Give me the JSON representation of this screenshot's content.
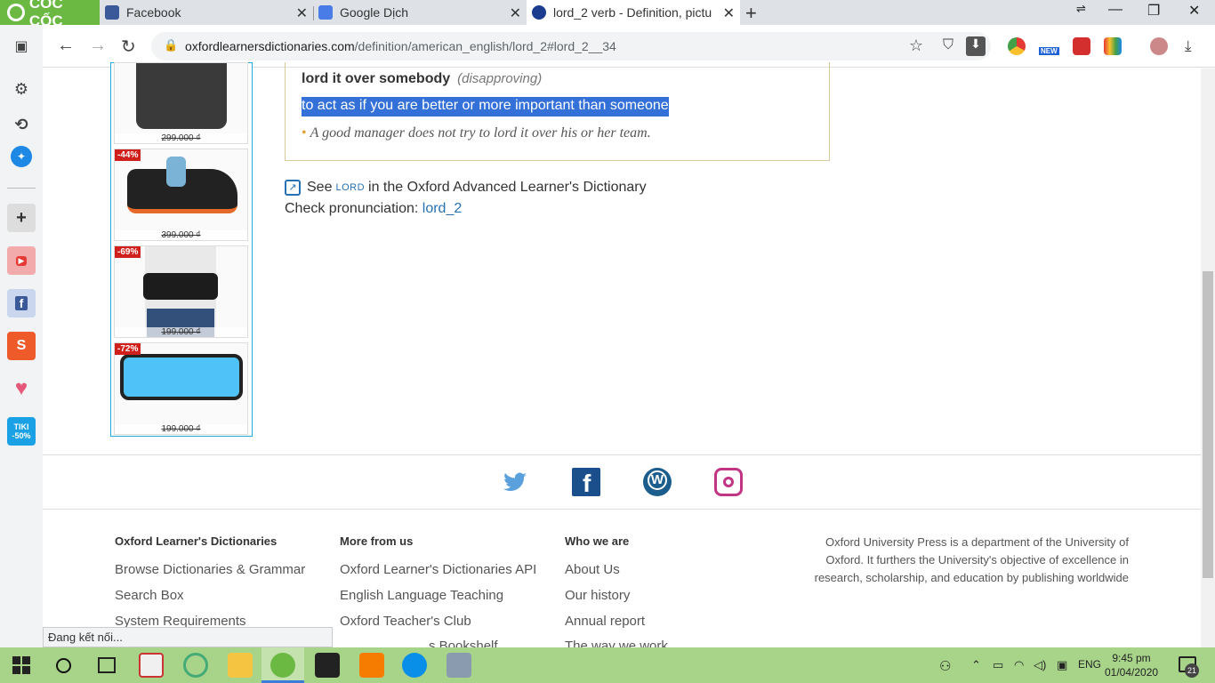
{
  "browser": {
    "brand": "CỐC CỐC",
    "tabs": [
      {
        "title": "Facebook"
      },
      {
        "title": "Google Dịch"
      },
      {
        "title": "lord_2 verb - Definition, pictu"
      }
    ],
    "url_host": "oxfordlearnersdictionaries.com",
    "url_path": "/definition/american_english/lord_2#lord_2__34",
    "status_text": "Đang kết nối...",
    "ext_new_badge": "NEW"
  },
  "sidebar": {
    "items": [
      "sidebar-toggle",
      "settings",
      "history",
      "messenger",
      "add",
      "youtube",
      "facebook",
      "shopee",
      "heart",
      "tiki"
    ],
    "tiki_label": "TIKI -50%"
  },
  "ads": [
    {
      "discount": "",
      "price": "299.000 ₫"
    },
    {
      "discount": "-44%",
      "price": "399.000 ₫"
    },
    {
      "discount": "-69%",
      "price": "199.000 ₫"
    },
    {
      "discount": "-72%",
      "price": "199.000 ₫"
    }
  ],
  "entry": {
    "phrase": "lord it over somebody",
    "label": "(disapproving)",
    "definition": "to act as if you are better or more important than someone",
    "example": "A good manager does not try to lord it over his or her team.",
    "see_prefix": "See",
    "see_word": "LORD",
    "see_suffix": "in the Oxford Advanced Learner's Dictionary",
    "pron_prefix": "Check pronunciation:",
    "pron_link": "lord_2"
  },
  "footer": {
    "social": [
      "twitter",
      "facebook",
      "wordpress",
      "instagram"
    ],
    "columns": [
      {
        "heading": "Oxford Learner's Dictionaries",
        "links": [
          "Browse Dictionaries & Grammar",
          "Search Box",
          "System Requirements"
        ]
      },
      {
        "heading": "More from us",
        "links": [
          "Oxford Learner's Dictionaries API",
          "English Language Teaching",
          "Oxford Teacher's Club",
          "s Bookshelf"
        ]
      },
      {
        "heading": "Who we are",
        "links": [
          "About Us",
          "Our history",
          "Annual report",
          "The way we work"
        ]
      }
    ],
    "about": "Oxford University Press is a department of the University of Oxford. It furthers the University's objective of excellence in research, scholarship, and education by publishing worldwide"
  },
  "taskbar": {
    "lang": "ENG",
    "time": "9:45 pm",
    "date": "01/04/2020",
    "notifications": "21"
  }
}
